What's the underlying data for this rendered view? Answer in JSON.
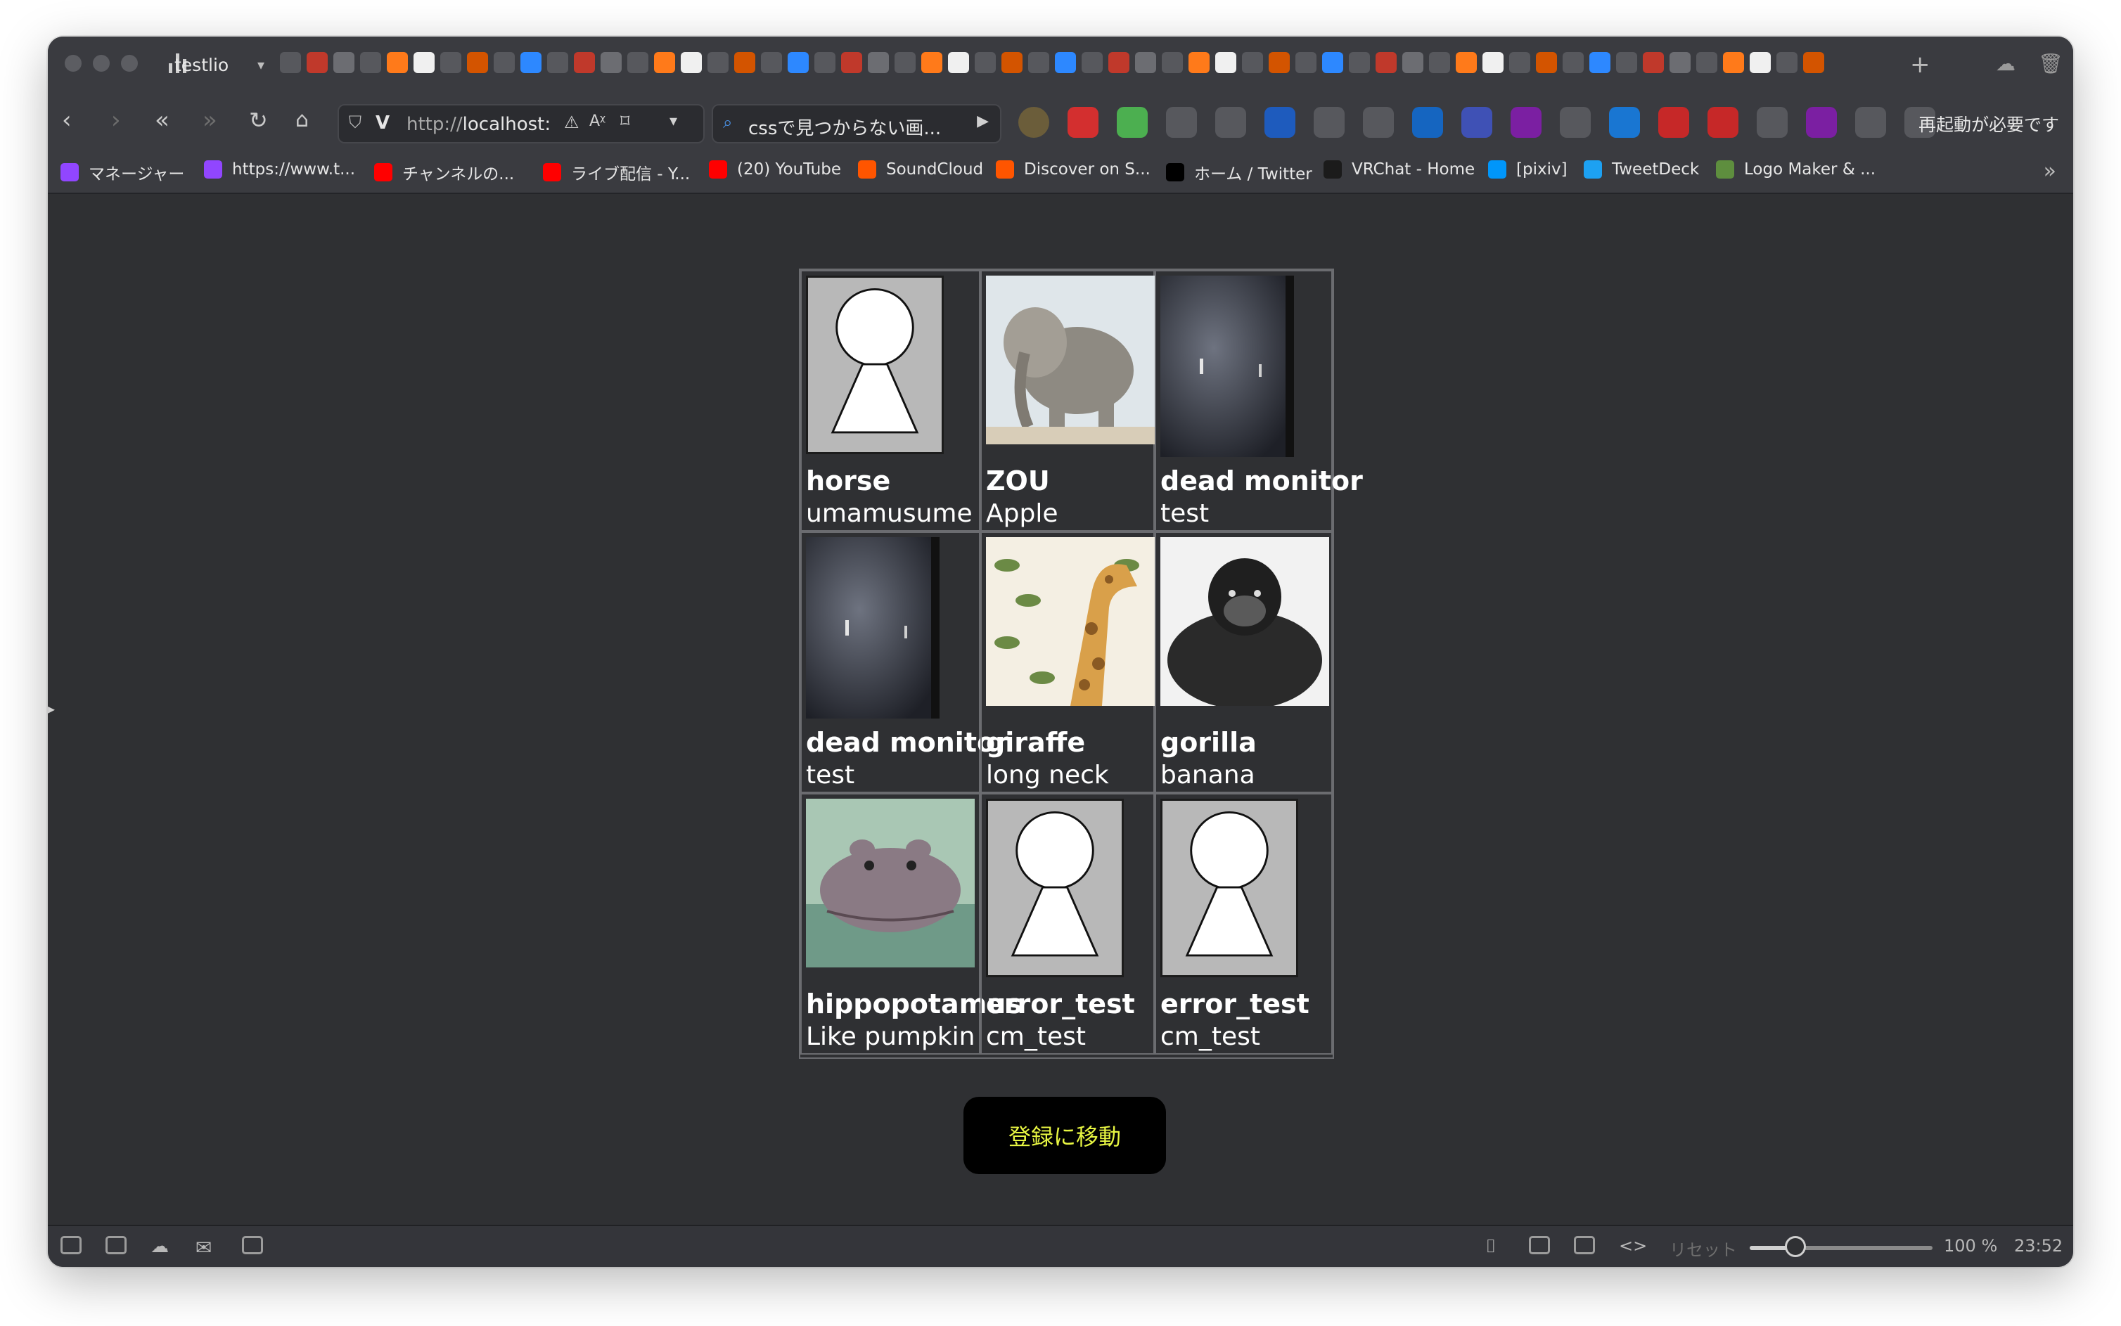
{
  "browser": {
    "tab": {
      "title": "testlio"
    },
    "url": {
      "prefix": "http://",
      "host": "localhost:"
    },
    "search": {
      "value": "cssで見つからない画..."
    },
    "restart_label": "再起動が必要です",
    "bookmarks": [
      {
        "label": "マネージャー",
        "color": "#9146ff"
      },
      {
        "label": "https://www.t...",
        "color": "#9146ff"
      },
      {
        "label": "チャンネルの...",
        "color": "#ff0000"
      },
      {
        "label": "ライブ配信 - Y...",
        "color": "#ff0000"
      },
      {
        "label": "(20) YouTube",
        "color": "#ff0000"
      },
      {
        "label": "SoundCloud",
        "color": "#ff5500"
      },
      {
        "label": "Discover on S...",
        "color": "#ff5500"
      },
      {
        "label": "ホーム / Twitter",
        "color": "#000000"
      },
      {
        "label": "VRChat - Home",
        "color": "#1b1b1b"
      },
      {
        "label": "[pixiv]",
        "color": "#0096fa"
      },
      {
        "label": "TweetDeck",
        "color": "#1da1f2"
      },
      {
        "label": "Logo Maker & ...",
        "color": "#5e8e3e"
      }
    ]
  },
  "content": {
    "cards": [
      {
        "name": "horse",
        "sub": "umamusume",
        "image": "placeholder"
      },
      {
        "name": "ZOU",
        "sub": "Apple",
        "image": "elephant"
      },
      {
        "name": "dead monitor",
        "sub": "test",
        "image": "monitor"
      },
      {
        "name": "dead monitor",
        "sub": "test",
        "image": "monitor"
      },
      {
        "name": "giraffe",
        "sub": "long neck",
        "image": "giraffe"
      },
      {
        "name": "gorilla",
        "sub": "banana",
        "image": "gorilla"
      },
      {
        "name": "hippopotamus",
        "sub": "Like pumpkin",
        "image": "hippo"
      },
      {
        "name": "error_test",
        "sub": "cm_test",
        "image": "placeholder"
      },
      {
        "name": "error_test",
        "sub": "cm_test",
        "image": "placeholder"
      }
    ],
    "register_button": "登録に移動",
    "register_button_color": "#e7f542"
  },
  "statusbar": {
    "reset_label": "リセット",
    "zoom_label": "100 %",
    "zoom_level": 0.25,
    "time": "23:52"
  }
}
